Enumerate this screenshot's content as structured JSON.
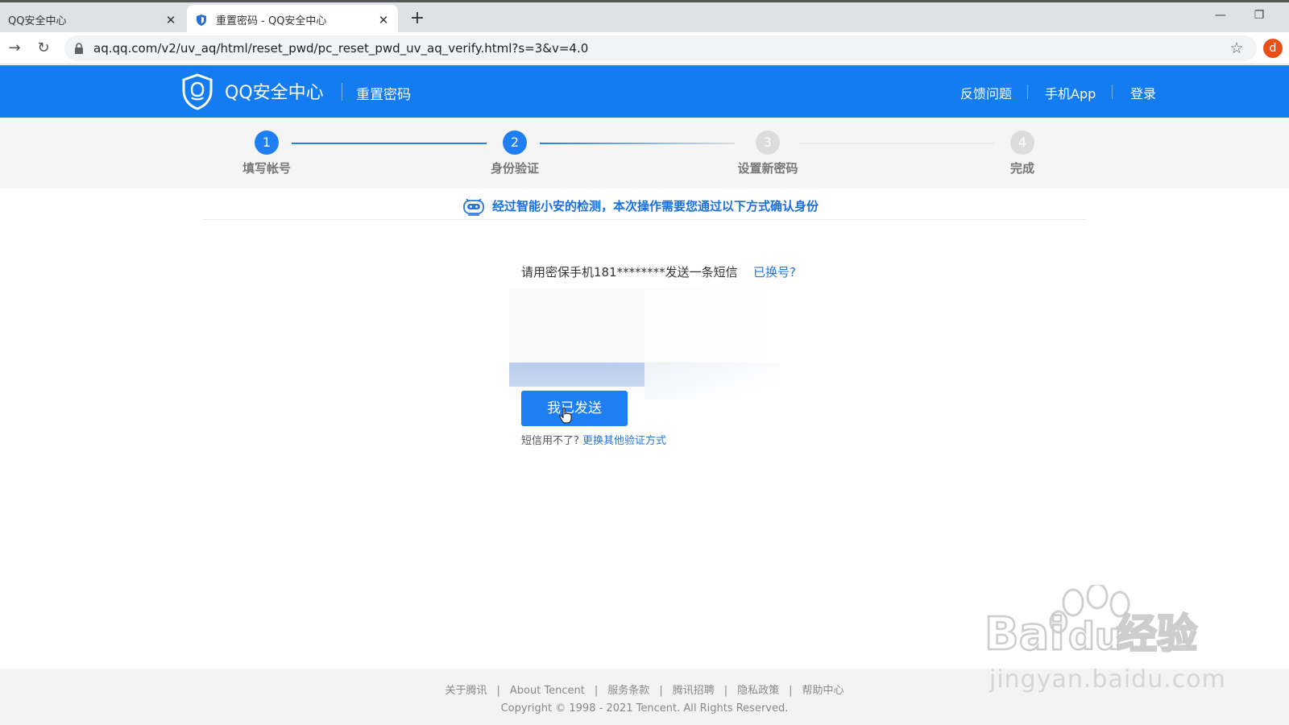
{
  "browser": {
    "tabs": [
      {
        "title": "QQ安全中心",
        "active": false
      },
      {
        "title": "重置密码 - QQ安全中心",
        "active": true
      }
    ],
    "url": "aq.qq.com/v2/uv_aq/html/reset_pwd/pc_reset_pwd_uv_aq_verify.html?s=3&v=4.0",
    "profile_initial": "d",
    "profile_color": "#e8501a"
  },
  "header": {
    "logo_text": "QQ安全中心",
    "subtitle": "重置密码",
    "links": [
      "反馈问题",
      "手机App",
      "登录"
    ],
    "bg_color": "#127cf0"
  },
  "steps": [
    {
      "number": "1",
      "label": "填写帐号",
      "state": "done"
    },
    {
      "number": "2",
      "label": "身份验证",
      "state": "current"
    },
    {
      "number": "3",
      "label": "设置新密码",
      "state": "pending"
    },
    {
      "number": "4",
      "label": "完成",
      "state": "pending"
    }
  ],
  "notice": {
    "text": "经过智能小安的检测，本次操作需要您通过以下方式确认身份"
  },
  "verify": {
    "instruction": "请用密保手机181********发送一条短信",
    "changed_link": "已换号?",
    "send_button": "我已发送",
    "alt_prefix": "短信用不了?",
    "alt_link": "更换其他验证方式"
  },
  "footer": {
    "links": [
      "关于腾讯",
      "About Tencent",
      "服务条款",
      "腾讯招聘",
      "隐私政策",
      "帮助中心"
    ],
    "copyright": "Copyright © 1998 - 2021 Tencent. All Rights Reserved."
  },
  "watermark": {
    "brand": "Bai",
    "brand2": "du",
    "brand_cn": "经验",
    "url": "jingyan.baidu.com"
  },
  "colors": {
    "accent": "#1e7ff5",
    "link": "#2a76d8"
  }
}
